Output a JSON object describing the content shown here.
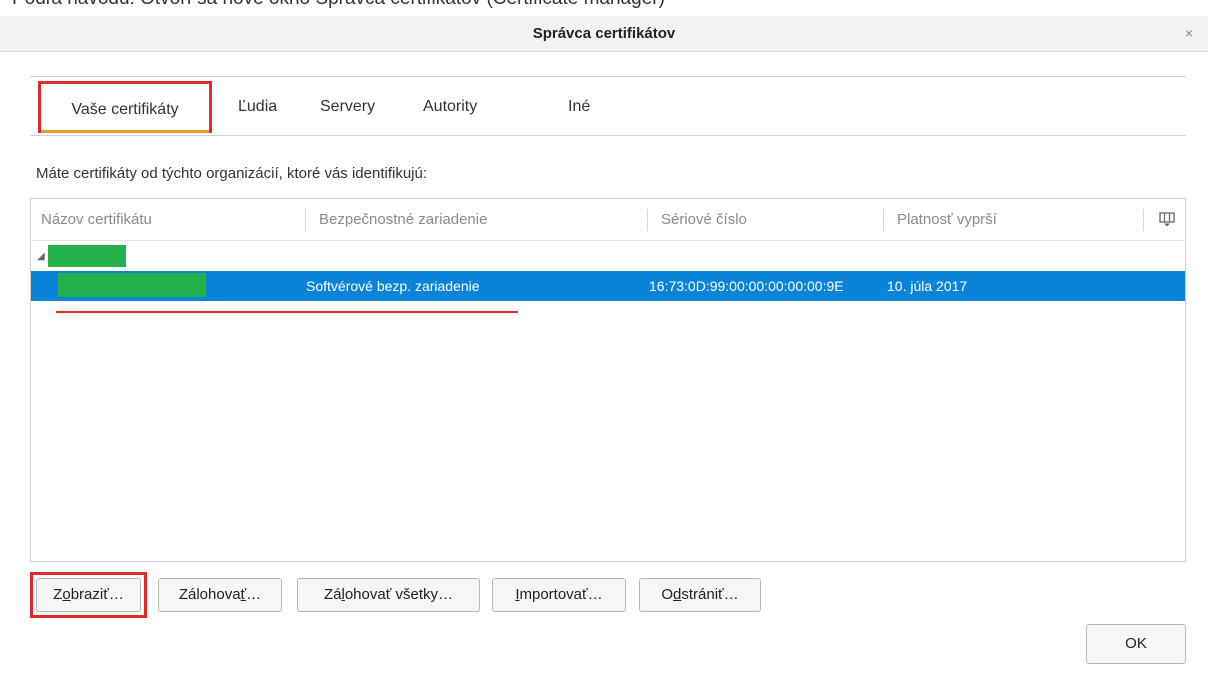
{
  "caption": "Podľa návodu: Otvorí sa nové okno Správca certifikátov (Certificate manager)",
  "window": {
    "title": "Správca certifikátov",
    "close_glyph": "×"
  },
  "tabs": [
    {
      "label": "Vaše certifikáty",
      "active": true
    },
    {
      "label": "Ľudia"
    },
    {
      "label": "Servery"
    },
    {
      "label": "Autority"
    },
    {
      "label": "Iné"
    }
  ],
  "intro_text": "Máte certifikáty od týchto organizácií, ktoré vás identifikujú:",
  "columns": [
    "Názov certifikátu",
    "Bezpečnostné zariadenie",
    "Sériové číslo",
    "Platnosť vyprší"
  ],
  "column_picker_icon": "column-picker-icon",
  "rows": [
    {
      "name": "",
      "device": "Softvérové bezp. zariadenie",
      "serial": "16:73:0D:99:00:00:00:00:00:9E",
      "expires": "10. júla 2017",
      "selected": true
    }
  ],
  "buttons": {
    "view": {
      "pre": "Z",
      "key": "o",
      "post": "braziť…"
    },
    "backup": {
      "pre": "Zálohova",
      "key": "ť",
      "post": "…"
    },
    "backup_all": {
      "pre": "Zá",
      "key": "l",
      "post": "ohovať všetky…"
    },
    "import": {
      "pre": "",
      "key": "I",
      "post": "mportovať…"
    },
    "delete": {
      "pre": "O",
      "key": "d",
      "post": "strániť…"
    }
  },
  "ok_label": "OK",
  "colors": {
    "selection": "#0a84d8",
    "highlight": "#e02b2b",
    "redaction": "#22b14c",
    "tab_underline": "#e69a3c"
  }
}
